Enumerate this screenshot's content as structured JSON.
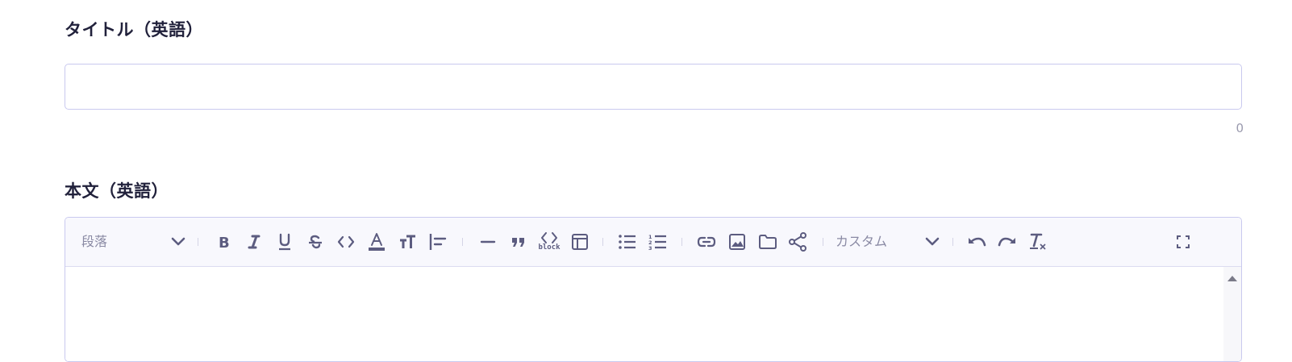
{
  "title_field": {
    "label": "タイトル（英語）",
    "value": "",
    "char_count": "0"
  },
  "body_field": {
    "label": "本文（英語）",
    "toolbar": {
      "paragraph_select": "段落",
      "custom_select": "カスタム",
      "code_block_caption": "block"
    }
  },
  "colors": {
    "text": "#21213b",
    "icon": "#5c5c80",
    "border": "#c9c9ef",
    "toolbar_bg": "#f8f8fd"
  }
}
